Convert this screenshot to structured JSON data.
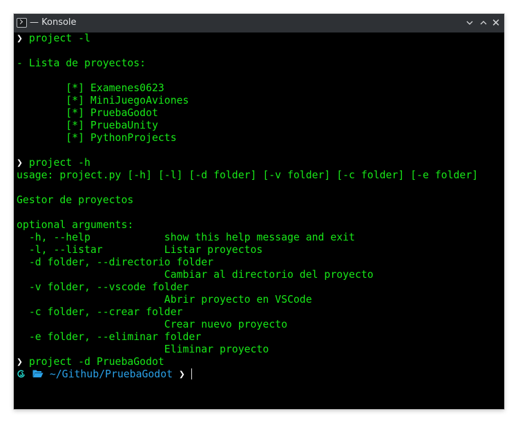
{
  "window": {
    "title": "— Konsole"
  },
  "terminal": {
    "lines": [
      {
        "type": "prompt",
        "prompt_symbol": "❯",
        "command": " project -l"
      },
      {
        "type": "text",
        "text": ""
      },
      {
        "type": "text",
        "text": "- Lista de proyectos:"
      },
      {
        "type": "text",
        "text": ""
      },
      {
        "type": "text",
        "text": "        [*] Examenes0623"
      },
      {
        "type": "text",
        "text": "        [*] MiniJuegoAviones"
      },
      {
        "type": "text",
        "text": "        [*] PruebaGodot"
      },
      {
        "type": "text",
        "text": "        [*] PruebaUnity"
      },
      {
        "type": "text",
        "text": "        [*] PythonProjects"
      },
      {
        "type": "text",
        "text": ""
      },
      {
        "type": "prompt",
        "prompt_symbol": "❯",
        "command": " project -h"
      },
      {
        "type": "text",
        "text": "usage: project.py [-h] [-l] [-d folder] [-v folder] [-c folder] [-e folder]"
      },
      {
        "type": "text",
        "text": ""
      },
      {
        "type": "text",
        "text": "Gestor de proyectos"
      },
      {
        "type": "text",
        "text": ""
      },
      {
        "type": "text",
        "text": "optional arguments:"
      },
      {
        "type": "text",
        "text": "  -h, --help            show this help message and exit"
      },
      {
        "type": "text",
        "text": "  -l, --listar          Listar proyectos"
      },
      {
        "type": "text",
        "text": "  -d folder, --directorio folder"
      },
      {
        "type": "text",
        "text": "                        Cambiar al directorio del proyecto"
      },
      {
        "type": "text",
        "text": "  -v folder, --vscode folder"
      },
      {
        "type": "text",
        "text": "                        Abrir proyecto en VSCode"
      },
      {
        "type": "text",
        "text": "  -c folder, --crear folder"
      },
      {
        "type": "text",
        "text": "                        Crear nuevo proyecto"
      },
      {
        "type": "text",
        "text": "  -e folder, --eliminar folder"
      },
      {
        "type": "text",
        "text": "                        Eliminar proyecto"
      },
      {
        "type": "prompt",
        "prompt_symbol": "❯",
        "command": " project -d PruebaGodot"
      }
    ],
    "current_prompt": {
      "os_icon": "debian-swirl-icon",
      "folder_icon": "folder-open-icon",
      "path_prefix": "~/Github/",
      "path_current": "PruebaGodot",
      "prompt_symbol": " ❯ "
    },
    "colors": {
      "text": "#18e818",
      "prompt_symbol": "#ffffff",
      "path": "#2aa1e8",
      "background": "#000000"
    }
  }
}
